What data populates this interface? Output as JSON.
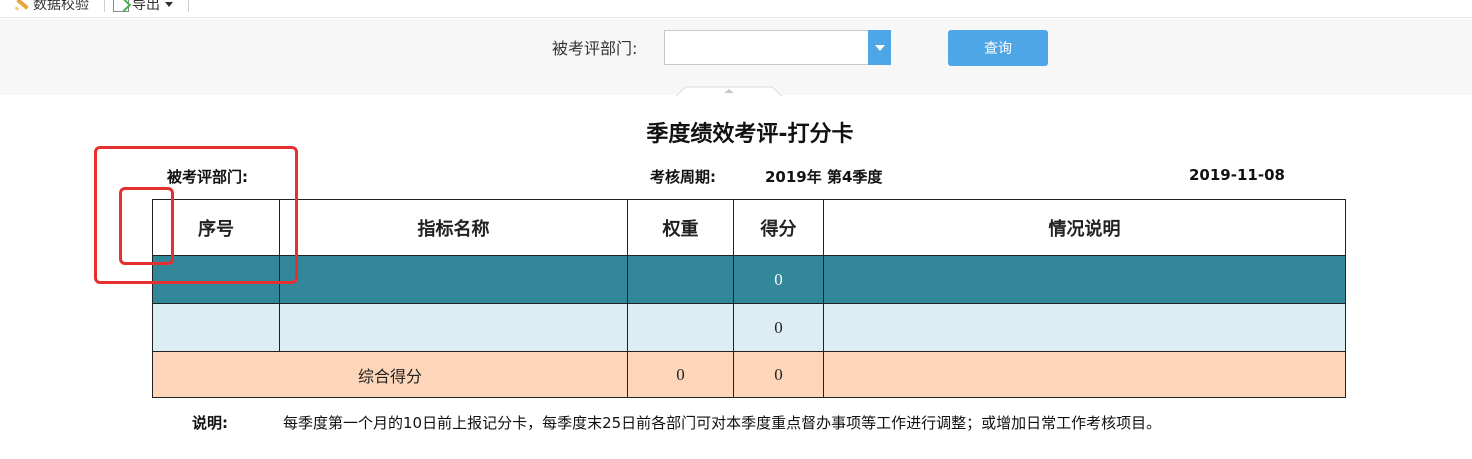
{
  "toolbar": {
    "validate": {
      "label": "数据校验",
      "icon": "pencil-icon"
    },
    "export": {
      "label": "导出",
      "icon": "export-icon"
    }
  },
  "filter": {
    "label": "被考评部门:",
    "selected_value": "",
    "query_button": "查询"
  },
  "report": {
    "title": "季度绩效考评-打分卡",
    "dept_label": "被考评部门:",
    "period_label": "考核周期:",
    "period_value": "2019年 第4季度",
    "date": "2019-11-08",
    "columns": [
      "序号",
      "指标名称",
      "权重",
      "得分",
      "情况说明"
    ],
    "rows": [
      {
        "index": "",
        "name": "",
        "weight": "",
        "score": "0",
        "note": ""
      },
      {
        "index": "",
        "name": "",
        "weight": "",
        "score": "0",
        "note": ""
      }
    ],
    "total": {
      "label": "综合得分",
      "weight": "0",
      "score": "0",
      "note": ""
    },
    "note_label": "说明:",
    "note_text": "每季度第一个月的10日前上报记分卡，每季度末25日前各部门可对本季度重点督办事项等工作进行调整；或增加日常工作考核项目。"
  },
  "colors": {
    "accent_blue": "#4ea6e6",
    "selected_row": "#33879a",
    "plain_row": "#dcedf3",
    "total_row": "#fdd5b8",
    "highlight_box": "#e53030"
  }
}
